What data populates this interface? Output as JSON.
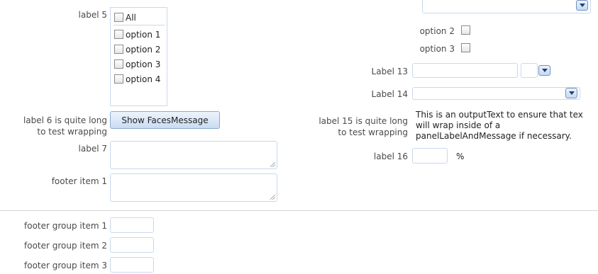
{
  "left": {
    "label5": "label 5",
    "all_label": "All",
    "options": [
      "option 1",
      "option 2",
      "option 3",
      "option 4"
    ],
    "label6_line1": "label 6 is quite long",
    "label6_line2": "to test wrapping",
    "show_button": "Show FacesMessage",
    "label7": "label 7",
    "footer_item1": "footer item 1"
  },
  "right": {
    "option2": "option 2",
    "option3": "option 3",
    "label13": "Label 13",
    "label14": "Label 14",
    "label15_line1": "label 15 is quite long",
    "label15_line2": "to test wrapping",
    "output_text": "This is an outputText to ensure that tex will wrap inside of a panelLabelAndMessage if necessary.",
    "label16": "label 16",
    "percent": "%"
  },
  "footer_group": {
    "items": [
      "footer group item 1",
      "footer group item 2",
      "footer group item 3"
    ]
  },
  "colors": {
    "input_border": "#c9d9ec",
    "button_border": "#8aa9d3",
    "divider": "#d6d6d6"
  }
}
